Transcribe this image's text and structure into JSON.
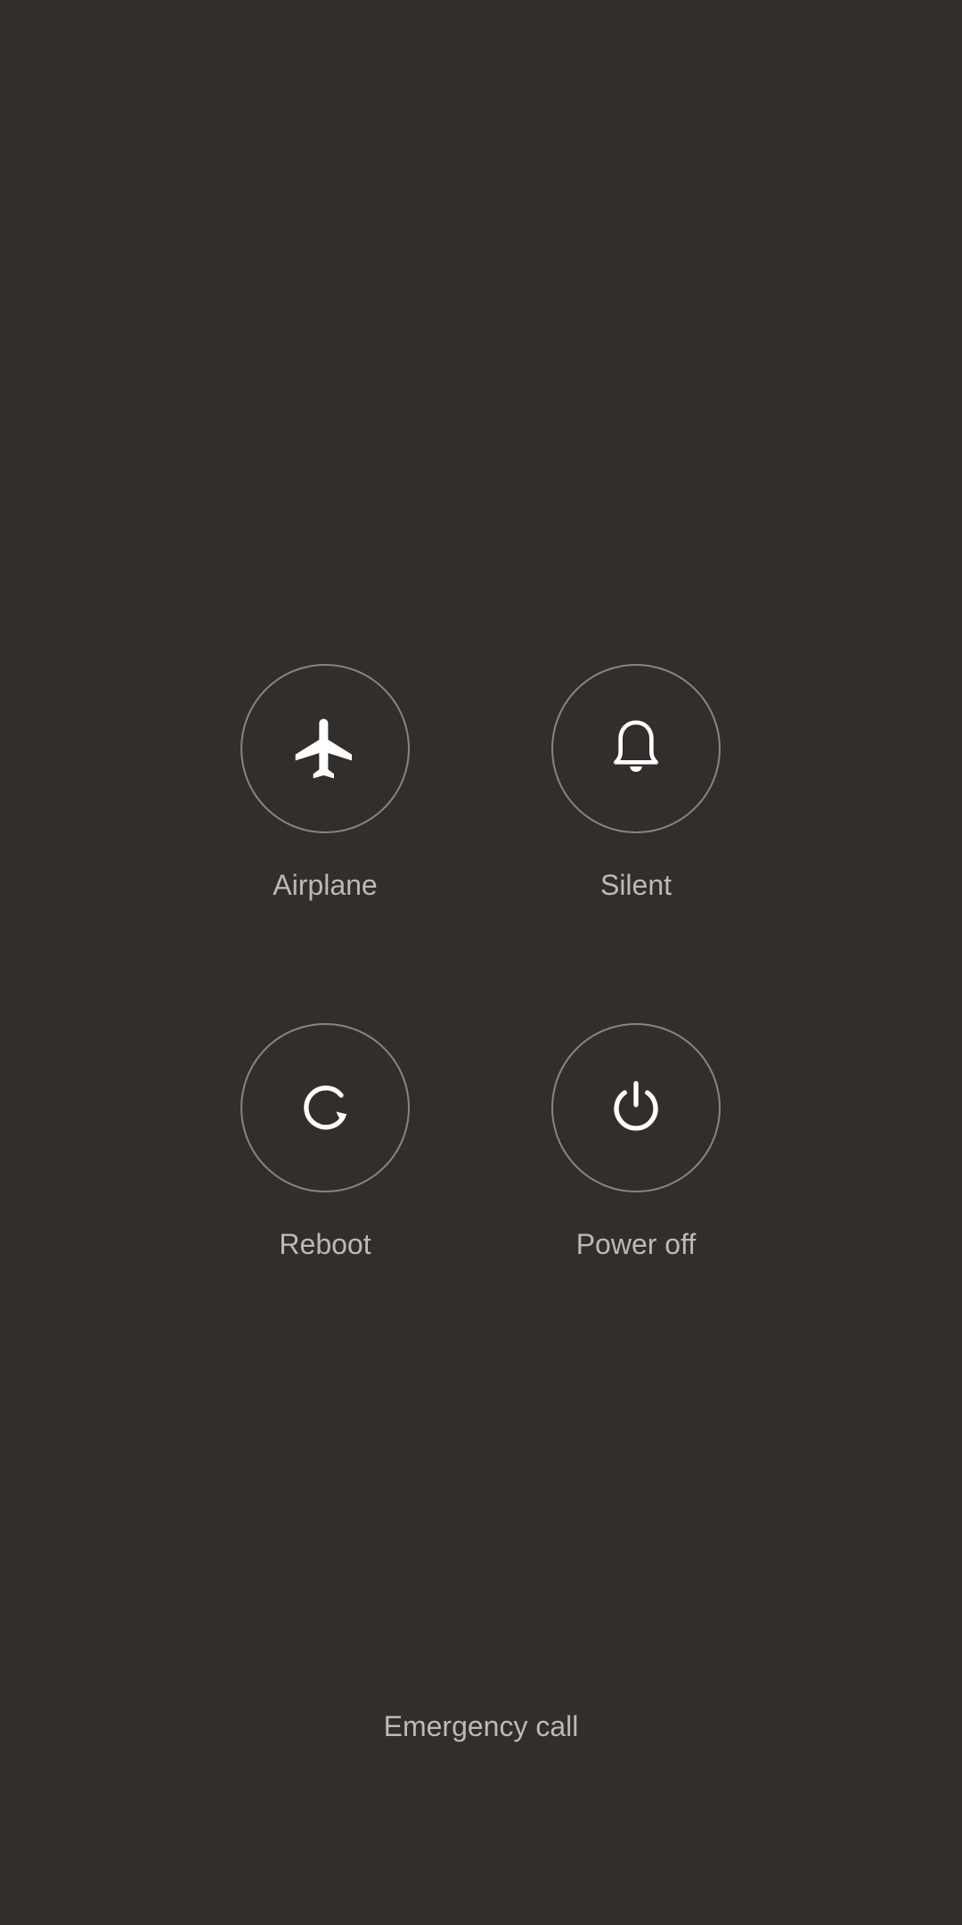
{
  "power_menu": {
    "actions": [
      {
        "label": "Airplane",
        "icon": "airplane-icon"
      },
      {
        "label": "Silent",
        "icon": "bell-icon"
      },
      {
        "label": "Reboot",
        "icon": "reboot-icon"
      },
      {
        "label": "Power off",
        "icon": "power-icon"
      }
    ],
    "emergency_call_label": "Emergency call"
  },
  "colors": {
    "background": "#322e2b",
    "circle_border": "#8a8581",
    "icon": "#ffffff",
    "label_text": "#bdb9b5"
  }
}
